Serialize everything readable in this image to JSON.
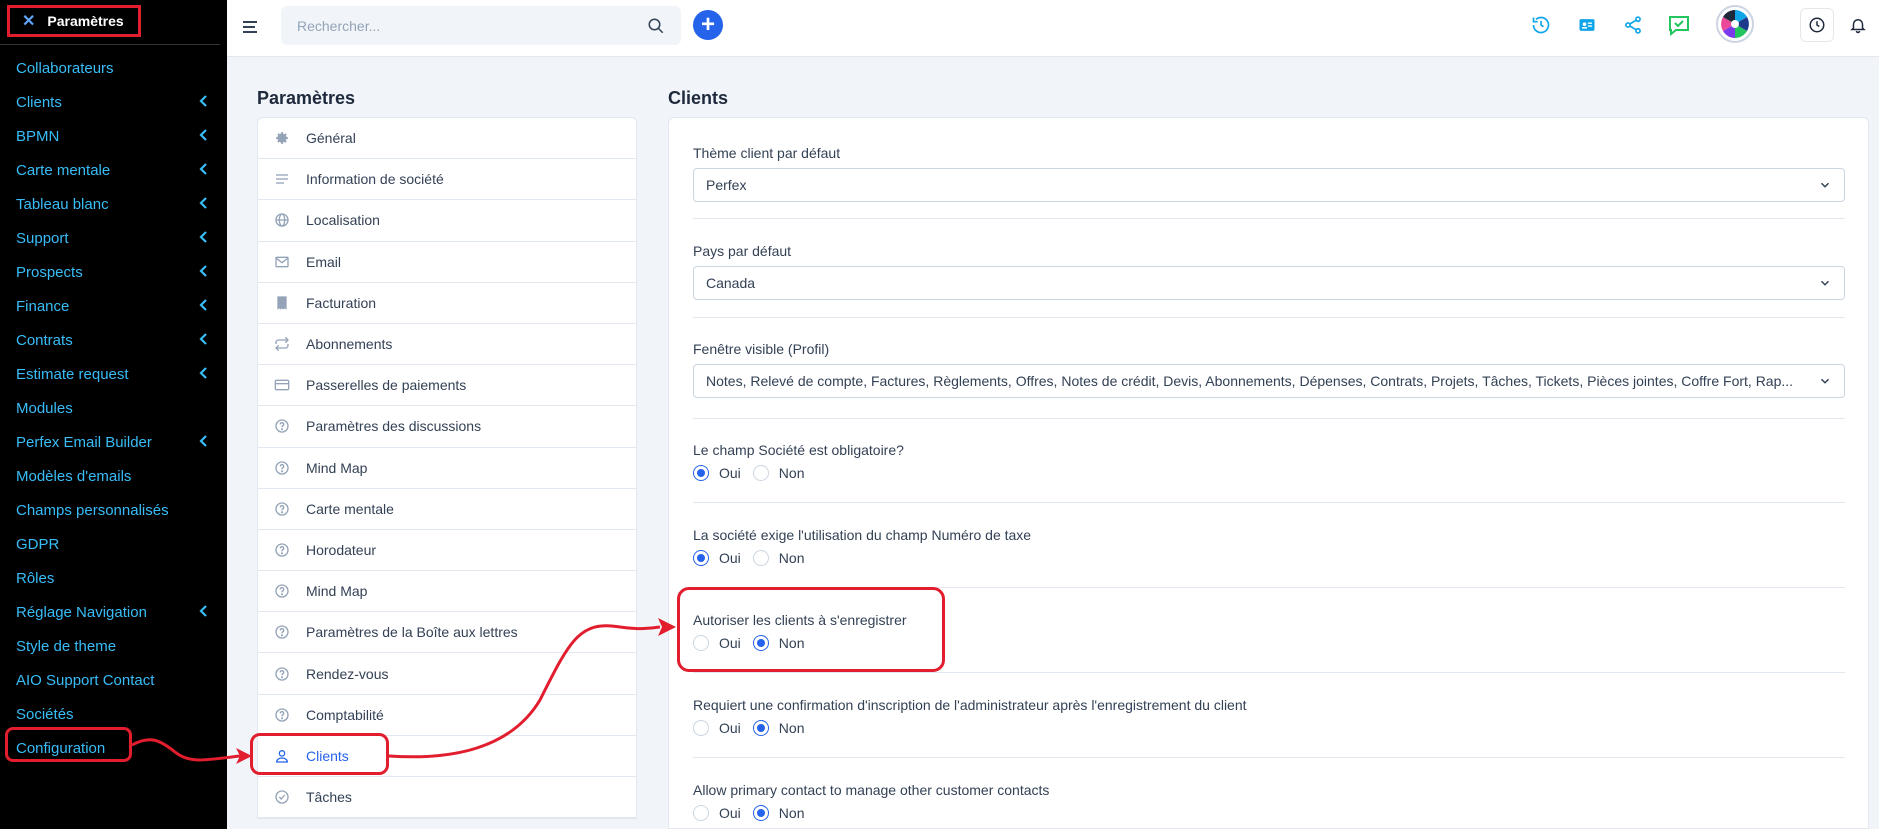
{
  "sidebar": {
    "header": "Paramètres",
    "items": [
      {
        "label": "Collaborateurs",
        "chevron": false
      },
      {
        "label": "Clients",
        "chevron": true
      },
      {
        "label": "BPMN",
        "chevron": true
      },
      {
        "label": "Carte mentale",
        "chevron": true
      },
      {
        "label": "Tableau blanc",
        "chevron": true
      },
      {
        "label": "Support",
        "chevron": true
      },
      {
        "label": "Prospects",
        "chevron": true
      },
      {
        "label": "Finance",
        "chevron": true
      },
      {
        "label": "Contrats",
        "chevron": true
      },
      {
        "label": "Estimate request",
        "chevron": true
      },
      {
        "label": "Modules",
        "chevron": false
      },
      {
        "label": "Perfex Email Builder",
        "chevron": true
      },
      {
        "label": "Modèles d'emails",
        "chevron": false
      },
      {
        "label": "Champs personnalisés",
        "chevron": false
      },
      {
        "label": "GDPR",
        "chevron": false
      },
      {
        "label": "Rôles",
        "chevron": false
      },
      {
        "label": "Réglage Navigation",
        "chevron": true
      },
      {
        "label": "Style de theme",
        "chevron": false
      },
      {
        "label": "AIO Support Contact",
        "chevron": false
      },
      {
        "label": "Sociétés",
        "chevron": false
      },
      {
        "label": "Configuration",
        "chevron": false
      }
    ]
  },
  "topbar": {
    "search_placeholder": "Rechercher...",
    "icons": [
      "history-icon",
      "contact-card-icon",
      "share-icon",
      "chat-icon",
      "clock-icon",
      "bell-icon"
    ]
  },
  "settings_panel": {
    "title": "Paramètres",
    "items": [
      {
        "label": "Général",
        "icon": "gear-icon"
      },
      {
        "label": "Information de société",
        "icon": "lines-icon"
      },
      {
        "label": "Localisation",
        "icon": "globe-icon"
      },
      {
        "label": "Email",
        "icon": "envelope-icon"
      },
      {
        "label": "Facturation",
        "icon": "invoice-icon"
      },
      {
        "label": "Abonnements",
        "icon": "repeat-icon"
      },
      {
        "label": "Passerelles de paiements",
        "icon": "credit-card-icon"
      },
      {
        "label": "Paramètres des discussions",
        "icon": "question-icon"
      },
      {
        "label": "Mind Map",
        "icon": "question-icon"
      },
      {
        "label": "Carte mentale",
        "icon": "question-icon"
      },
      {
        "label": "Horodateur",
        "icon": "question-icon"
      },
      {
        "label": "Mind Map",
        "icon": "question-icon"
      },
      {
        "label": "Paramètres de la Boîte aux lettres",
        "icon": "question-icon"
      },
      {
        "label": "Rendez-vous",
        "icon": "question-icon"
      },
      {
        "label": "Comptabilité",
        "icon": "question-icon"
      },
      {
        "label": "Clients",
        "icon": "user-icon",
        "active": true
      },
      {
        "label": "Tâches",
        "icon": "check-circle-icon"
      }
    ]
  },
  "content": {
    "title": "Clients",
    "theme": {
      "label": "Thème client par défaut",
      "value": "Perfex"
    },
    "country": {
      "label": "Pays par défaut",
      "value": "Canada"
    },
    "visible": {
      "label": "Fenêtre visible (Profil)",
      "value": "Notes, Relevé de compte, Factures, Règlements, Offres, Notes de crédit, Devis, Abonnements, Dépenses, Contrats, Projets, Tâches, Tickets, Pièces jointes, Coffre Fort, Rap..."
    },
    "yes": "Oui",
    "no": "Non",
    "questions": [
      {
        "label": "Le champ Société est obligatoire?",
        "selected": "yes"
      },
      {
        "label": "La société exige l'utilisation du champ Numéro de taxe",
        "selected": "yes"
      },
      {
        "label": "Autoriser les clients à s'enregistrer",
        "selected": "no"
      },
      {
        "label": "Requiert une confirmation d'inscription de l'administrateur après l'enregistrement du client",
        "selected": "no"
      },
      {
        "label": "Allow primary contact to manage other customer contacts",
        "selected": "no"
      }
    ]
  }
}
